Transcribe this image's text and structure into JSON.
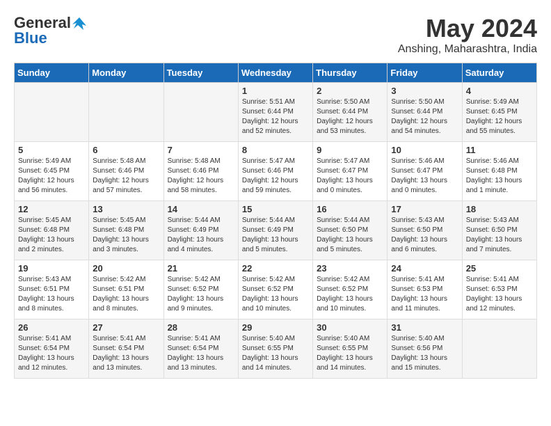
{
  "header": {
    "logo_line1": "General",
    "logo_line2": "Blue",
    "month_year": "May 2024",
    "location": "Anshing, Maharashtra, India"
  },
  "days_of_week": [
    "Sunday",
    "Monday",
    "Tuesday",
    "Wednesday",
    "Thursday",
    "Friday",
    "Saturday"
  ],
  "weeks": [
    [
      {
        "day": "",
        "info": ""
      },
      {
        "day": "",
        "info": ""
      },
      {
        "day": "",
        "info": ""
      },
      {
        "day": "1",
        "info": "Sunrise: 5:51 AM\nSunset: 6:44 PM\nDaylight: 12 hours\nand 52 minutes."
      },
      {
        "day": "2",
        "info": "Sunrise: 5:50 AM\nSunset: 6:44 PM\nDaylight: 12 hours\nand 53 minutes."
      },
      {
        "day": "3",
        "info": "Sunrise: 5:50 AM\nSunset: 6:44 PM\nDaylight: 12 hours\nand 54 minutes."
      },
      {
        "day": "4",
        "info": "Sunrise: 5:49 AM\nSunset: 6:45 PM\nDaylight: 12 hours\nand 55 minutes."
      }
    ],
    [
      {
        "day": "5",
        "info": "Sunrise: 5:49 AM\nSunset: 6:45 PM\nDaylight: 12 hours\nand 56 minutes."
      },
      {
        "day": "6",
        "info": "Sunrise: 5:48 AM\nSunset: 6:46 PM\nDaylight: 12 hours\nand 57 minutes."
      },
      {
        "day": "7",
        "info": "Sunrise: 5:48 AM\nSunset: 6:46 PM\nDaylight: 12 hours\nand 58 minutes."
      },
      {
        "day": "8",
        "info": "Sunrise: 5:47 AM\nSunset: 6:46 PM\nDaylight: 12 hours\nand 59 minutes."
      },
      {
        "day": "9",
        "info": "Sunrise: 5:47 AM\nSunset: 6:47 PM\nDaylight: 13 hours\nand 0 minutes."
      },
      {
        "day": "10",
        "info": "Sunrise: 5:46 AM\nSunset: 6:47 PM\nDaylight: 13 hours\nand 0 minutes."
      },
      {
        "day": "11",
        "info": "Sunrise: 5:46 AM\nSunset: 6:48 PM\nDaylight: 13 hours\nand 1 minute."
      }
    ],
    [
      {
        "day": "12",
        "info": "Sunrise: 5:45 AM\nSunset: 6:48 PM\nDaylight: 13 hours\nand 2 minutes."
      },
      {
        "day": "13",
        "info": "Sunrise: 5:45 AM\nSunset: 6:48 PM\nDaylight: 13 hours\nand 3 minutes."
      },
      {
        "day": "14",
        "info": "Sunrise: 5:44 AM\nSunset: 6:49 PM\nDaylight: 13 hours\nand 4 minutes."
      },
      {
        "day": "15",
        "info": "Sunrise: 5:44 AM\nSunset: 6:49 PM\nDaylight: 13 hours\nand 5 minutes."
      },
      {
        "day": "16",
        "info": "Sunrise: 5:44 AM\nSunset: 6:50 PM\nDaylight: 13 hours\nand 5 minutes."
      },
      {
        "day": "17",
        "info": "Sunrise: 5:43 AM\nSunset: 6:50 PM\nDaylight: 13 hours\nand 6 minutes."
      },
      {
        "day": "18",
        "info": "Sunrise: 5:43 AM\nSunset: 6:50 PM\nDaylight: 13 hours\nand 7 minutes."
      }
    ],
    [
      {
        "day": "19",
        "info": "Sunrise: 5:43 AM\nSunset: 6:51 PM\nDaylight: 13 hours\nand 8 minutes."
      },
      {
        "day": "20",
        "info": "Sunrise: 5:42 AM\nSunset: 6:51 PM\nDaylight: 13 hours\nand 8 minutes."
      },
      {
        "day": "21",
        "info": "Sunrise: 5:42 AM\nSunset: 6:52 PM\nDaylight: 13 hours\nand 9 minutes."
      },
      {
        "day": "22",
        "info": "Sunrise: 5:42 AM\nSunset: 6:52 PM\nDaylight: 13 hours\nand 10 minutes."
      },
      {
        "day": "23",
        "info": "Sunrise: 5:42 AM\nSunset: 6:52 PM\nDaylight: 13 hours\nand 10 minutes."
      },
      {
        "day": "24",
        "info": "Sunrise: 5:41 AM\nSunset: 6:53 PM\nDaylight: 13 hours\nand 11 minutes."
      },
      {
        "day": "25",
        "info": "Sunrise: 5:41 AM\nSunset: 6:53 PM\nDaylight: 13 hours\nand 12 minutes."
      }
    ],
    [
      {
        "day": "26",
        "info": "Sunrise: 5:41 AM\nSunset: 6:54 PM\nDaylight: 13 hours\nand 12 minutes."
      },
      {
        "day": "27",
        "info": "Sunrise: 5:41 AM\nSunset: 6:54 PM\nDaylight: 13 hours\nand 13 minutes."
      },
      {
        "day": "28",
        "info": "Sunrise: 5:41 AM\nSunset: 6:54 PM\nDaylight: 13 hours\nand 13 minutes."
      },
      {
        "day": "29",
        "info": "Sunrise: 5:40 AM\nSunset: 6:55 PM\nDaylight: 13 hours\nand 14 minutes."
      },
      {
        "day": "30",
        "info": "Sunrise: 5:40 AM\nSunset: 6:55 PM\nDaylight: 13 hours\nand 14 minutes."
      },
      {
        "day": "31",
        "info": "Sunrise: 5:40 AM\nSunset: 6:56 PM\nDaylight: 13 hours\nand 15 minutes."
      },
      {
        "day": "",
        "info": ""
      }
    ]
  ]
}
